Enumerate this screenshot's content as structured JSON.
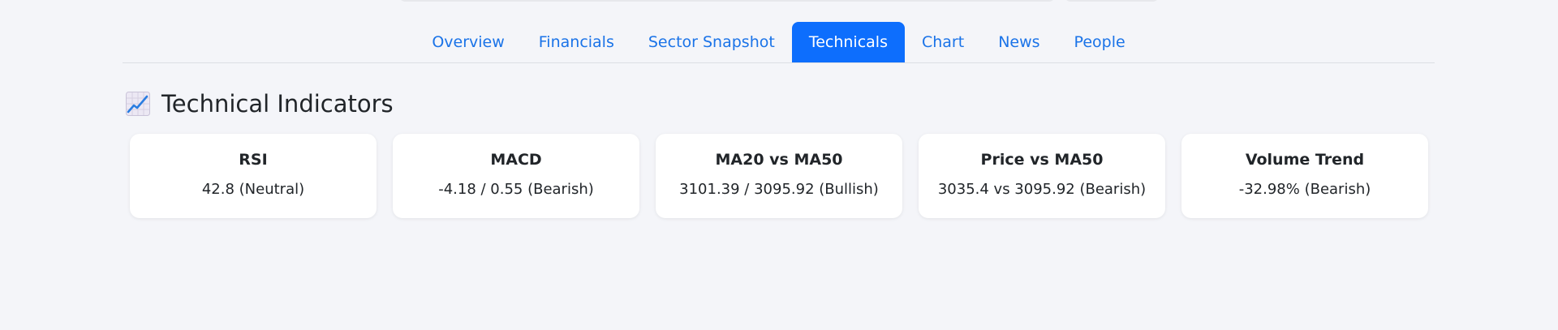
{
  "tabs": [
    {
      "label": "Overview",
      "active": false
    },
    {
      "label": "Financials",
      "active": false
    },
    {
      "label": "Sector Snapshot",
      "active": false
    },
    {
      "label": "Technicals",
      "active": true
    },
    {
      "label": "Chart",
      "active": false
    },
    {
      "label": "News",
      "active": false
    },
    {
      "label": "People",
      "active": false
    }
  ],
  "section": {
    "icon": "chart-increasing-icon",
    "title": "Technical Indicators"
  },
  "indicators": [
    {
      "title": "RSI",
      "value": "42.8 (Neutral)"
    },
    {
      "title": "MACD",
      "value": "-4.18 / 0.55 (Bearish)"
    },
    {
      "title": "MA20 vs MA50",
      "value": "3101.39 / 3095.92 (Bullish)"
    },
    {
      "title": "Price vs MA50",
      "value": "3035.4 vs 3095.92 (Bearish)"
    },
    {
      "title": "Volume Trend",
      "value": "-32.98% (Bearish)"
    }
  ],
  "colors": {
    "accent": "#0d6efd",
    "tab_text": "#1a73e8",
    "background": "#f4f5f9",
    "card": "#ffffff"
  }
}
